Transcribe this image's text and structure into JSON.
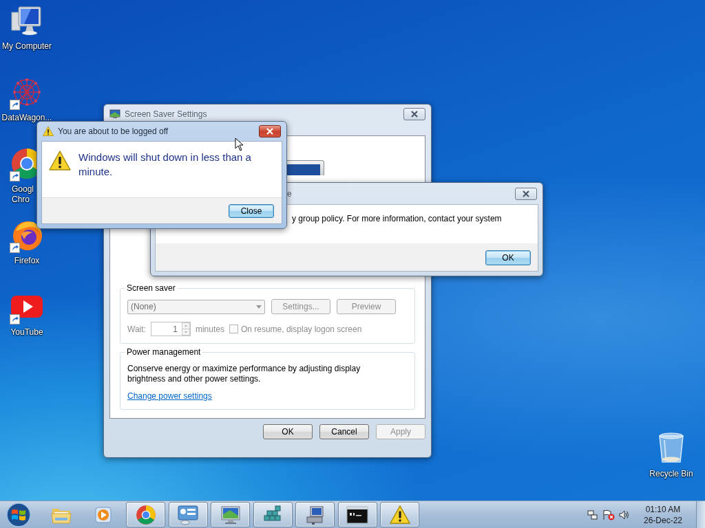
{
  "desktop_icons": [
    {
      "kind": "computer",
      "label": "My Computer",
      "shortcut": false
    },
    {
      "kind": "datawagon",
      "label": "DataWagon...",
      "shortcut": true
    },
    {
      "kind": "chrome",
      "label": "Googl\nChro",
      "shortcut": true
    },
    {
      "kind": "firefox",
      "label": "Firefox",
      "shortcut": true
    },
    {
      "kind": "youtube",
      "label": "YouTube",
      "shortcut": true
    }
  ],
  "recycle_bin": {
    "label": "Recycle Bin"
  },
  "screen_saver_window": {
    "title": "Screen Saver Settings",
    "screen_saver": {
      "legend": "Screen saver",
      "disabled": true,
      "selection": "(None)",
      "settings_button": "Settings...",
      "preview_button": "Preview",
      "wait_label": "Wait:",
      "wait_value": "1",
      "minutes_label": "minutes",
      "logon_checkbox": {
        "label": "On resume, display logon screen",
        "checked": false
      }
    },
    "power_management": {
      "legend": "Power management",
      "description": "Conserve energy or maximize performance by adjusting display brightness and other power settings.",
      "link": "Change power settings"
    },
    "buttons": [
      {
        "label": "OK",
        "disabled": false
      },
      {
        "label": "Cancel",
        "disabled": false
      },
      {
        "label": "Apply",
        "disabled": true
      }
    ]
  },
  "policy_dialog": {
    "title": "e",
    "message": "y group policy. For more information, contact your system",
    "button": {
      "label": "OK",
      "focused": true
    }
  },
  "logoff_dialog": {
    "title": "You are about to be logged off",
    "message": "Windows will shut down in less than a minute.",
    "button": {
      "label": "Close",
      "focused": true
    }
  },
  "taskbar": {
    "items": [
      {
        "kind": "explorer",
        "running": false
      },
      {
        "kind": "media",
        "running": false
      },
      {
        "kind": "chrome",
        "running": true
      },
      {
        "kind": "control",
        "running": true
      },
      {
        "kind": "display",
        "running": true
      },
      {
        "kind": "registry",
        "running": true
      },
      {
        "kind": "network",
        "running": true
      },
      {
        "kind": "terminal",
        "running": true
      },
      {
        "kind": "warning",
        "running": true
      }
    ],
    "clock": {
      "time": "01:10 AM",
      "date": "26-Dec-22"
    }
  }
}
